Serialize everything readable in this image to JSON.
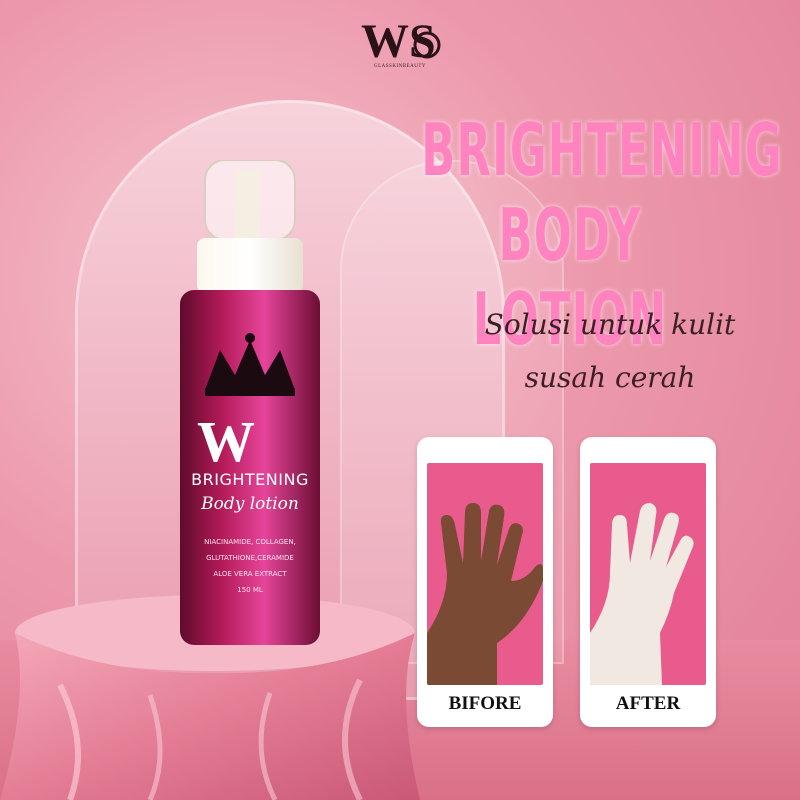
{
  "brand": {
    "logo_letters": "WS",
    "logo_subtitle": "GLASSKINBEAUTY"
  },
  "headline": {
    "line1": "BRIGHTENING",
    "line2": "BODY LOTION"
  },
  "tagline": {
    "line1": "Solusi untuk kulit",
    "line2": "susah cerah"
  },
  "product": {
    "label_brand": "BRIGHTENING",
    "label_script": "Body lotion",
    "ingredients_line1": "NIACINAMIDE, COLLAGEN,",
    "ingredients_line2": "GLUTATHIONE,CERAMIDE",
    "ingredients_line3": "ALOE VERA EXTRACT",
    "volume": "150 ML"
  },
  "comparison": {
    "before_label": "BIFORE",
    "after_label": "AFTER"
  },
  "colors": {
    "background": "#ec98ab",
    "headline": "#ff83bf",
    "card_photo": "#e85b8c",
    "bottle_label": "#a0174e"
  }
}
